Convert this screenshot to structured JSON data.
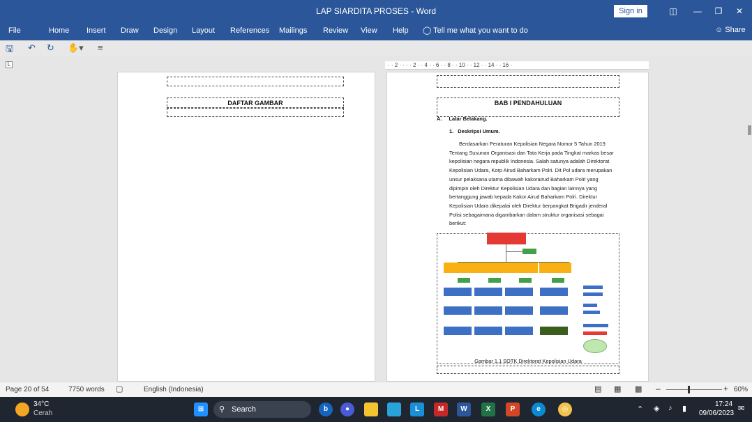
{
  "titlebar": {
    "title": "LAP SIARDITA PROSES  -  Word",
    "signin": "Sign in",
    "icons": {
      "ribbon": "ribbon-display-icon",
      "minimize": "minimize-icon",
      "maximize": "restore-icon",
      "close": "close-icon"
    }
  },
  "ribbon": {
    "tabs": [
      "File",
      "Home",
      "Insert",
      "Draw",
      "Design",
      "Layout",
      "References",
      "Mailings",
      "Review",
      "View",
      "Help"
    ],
    "tellme": "Tell me what you want to do",
    "share": "Share"
  },
  "qat": {
    "icons": [
      "save-icon",
      "undo-icon",
      "redo-icon",
      "touch-mode-icon",
      "customize-qat-icon"
    ]
  },
  "ruler": {
    "left_marker": "L",
    "text": "· · 2 · · · · 2 · · 4 · · 6 · · 8 · · 10 · · 12 · · 14 · · 16 ·"
  },
  "left_page": {
    "heading": "DAFTAR GAMBAR"
  },
  "right_page": {
    "heading": "BAB I PENDAHULUAN",
    "section_letter": "A.",
    "section_title": "Latar Belakang.",
    "subsection_num": "1.",
    "subsection_title": "Deskripsi Umum.",
    "paragraph_lines": [
      "Berdasarkan Peraturan Kepolisian Negara Nomor 5 Tahun 2019",
      "Tentang Susunan Organisasi dan Tata Kerja pada Tingkat markas besar",
      "kepolisian negara republik Indonesia. Salah satunya adalah Direktorat",
      "Kepolisian Udara, Korp Airud Baharkam Polri.  Dit Pol udara merupakan",
      "unsur pelaksana utama dibawah kakorairud Baharkam Polri yang",
      "dipimpin oleh Direktur Kepolisian Udara dan bagian lainnya yang",
      "bertanggung jawab kepada Kakor Airud Baharkam Polri. Direktur",
      "Kepolisian Udara dikepalai oleh Direktur berpangkat Brigadir jenderal",
      "Polisi sebagaimana digambarkan dalam struktur organisasi sebagai",
      "berikut:"
    ],
    "caption": "Gambar 1.1 SOTK Direktorat Kepolisian Udara"
  },
  "statusbar": {
    "page": "Page 20 of 54",
    "words": "7750 words",
    "language": "English (Indonesia)",
    "zoom": "60%",
    "zoom_fraction": 0.6,
    "icons": [
      "proofing-icon",
      "read-mode-icon",
      "print-layout-icon",
      "web-layout-icon",
      "zoom-out-icon",
      "zoom-in-icon"
    ]
  },
  "taskbar": {
    "weather_temp": "34°C",
    "weather_desc": "Cerah",
    "search": "Search",
    "time": "17:24",
    "date": "09/06/2023",
    "apps": [
      "windows-start-icon",
      "search-icon",
      "bing-icon",
      "meet-icon",
      "file-explorer-icon",
      "photos-icon",
      "learning-icon",
      "mcafee-icon",
      "word-icon",
      "excel-icon",
      "powerpoint-icon",
      "edge-icon",
      "chrome-icon"
    ],
    "tray": [
      "chevron-up-icon",
      "wifi-icon",
      "volume-icon",
      "battery-icon",
      "notification-icon"
    ]
  }
}
